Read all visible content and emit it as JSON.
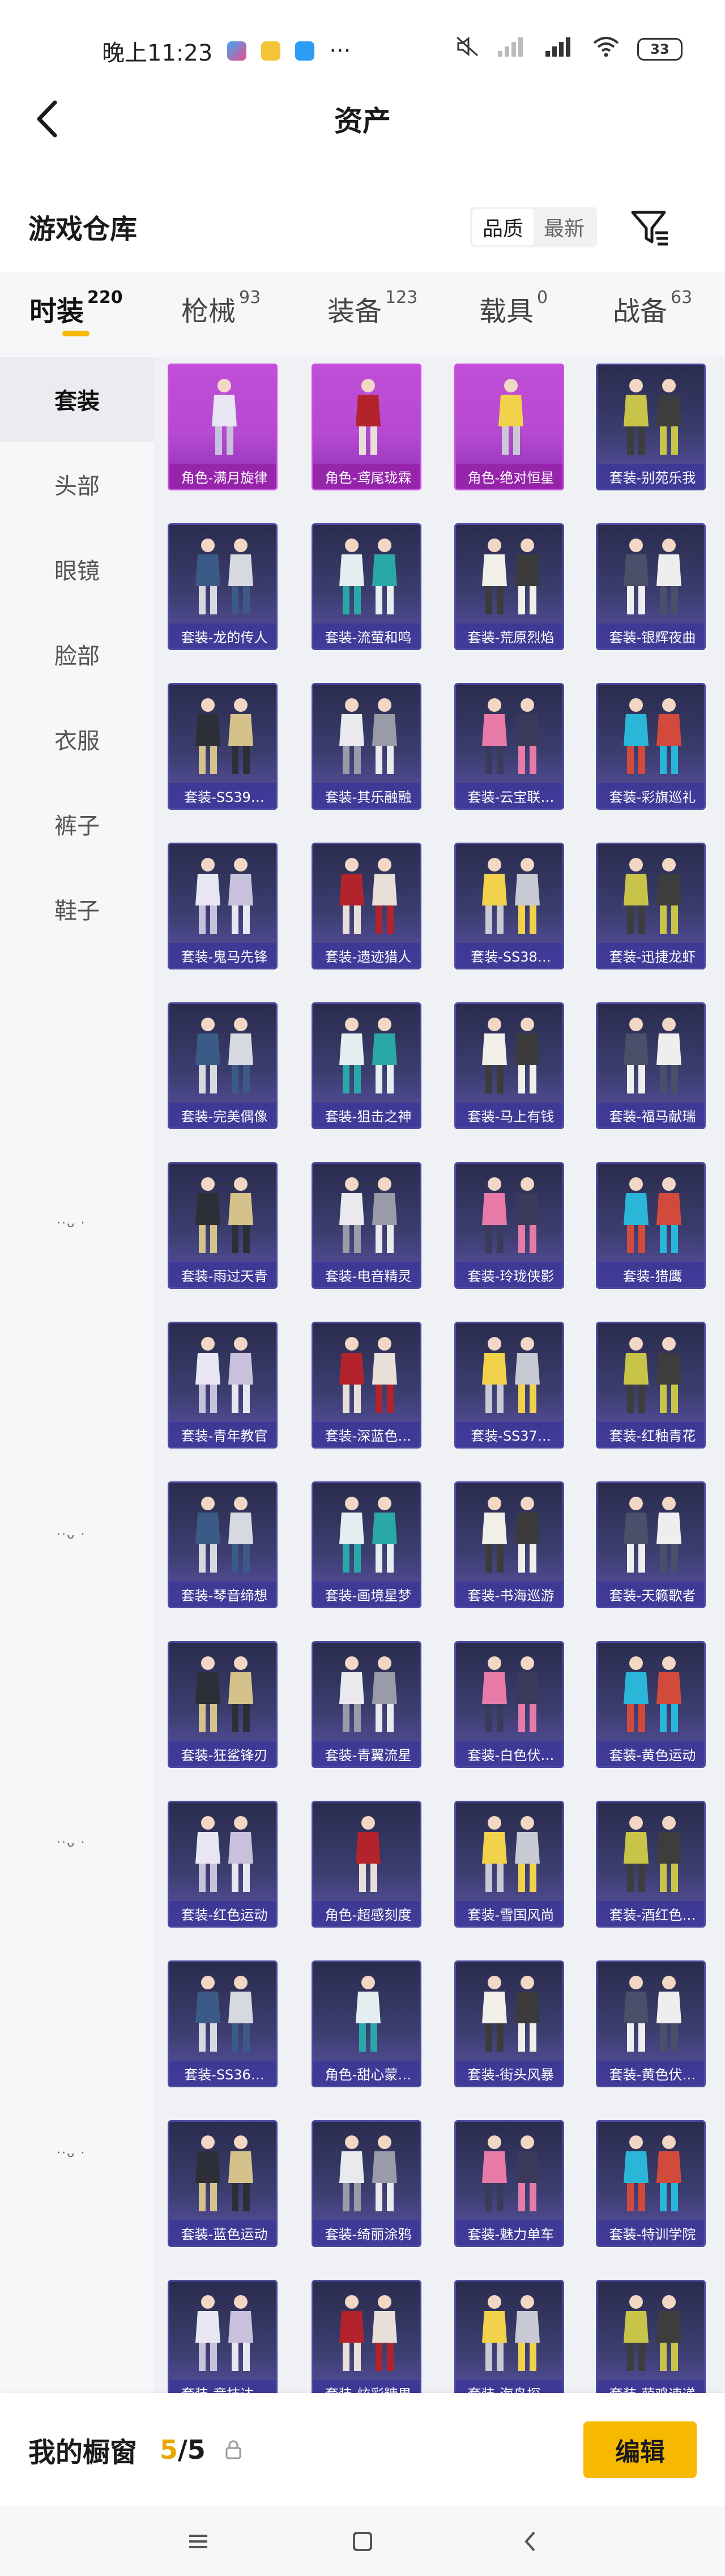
{
  "status_bar": {
    "time": "晚上11:23",
    "more": "···",
    "battery": "33"
  },
  "header": {
    "title": "资产"
  },
  "warehouse": {
    "title": "游戏仓库",
    "sort_options": [
      "品质",
      "最新"
    ]
  },
  "tabs": [
    {
      "label": "时装",
      "count": "220"
    },
    {
      "label": "枪械",
      "count": "93"
    },
    {
      "label": "装备",
      "count": "123"
    },
    {
      "label": "载具",
      "count": "0"
    },
    {
      "label": "战备",
      "count": "63"
    }
  ],
  "sidebar": {
    "items": [
      "套装",
      "头部",
      "眼镜",
      "脸部",
      "衣服",
      "裤子",
      "鞋子"
    ],
    "ghost": "··ᴗ ·"
  },
  "grid": {
    "items": [
      "角色-满月旋律",
      "角色-鸢尾珑霖",
      "角色-绝对恒星",
      "套装-别苑乐我",
      "套装-龙的传人",
      "套装-流萤和鸣",
      "套装-荒原烈焰",
      "套装-银辉夜曲",
      "套装-SS39…",
      "套装-其乐融融",
      "套装-云宝联…",
      "套装-彩旗巡礼",
      "套装-鬼马先锋",
      "套装-遗迹猎人",
      "套装-SS38…",
      "套装-迅捷龙虾",
      "套装-完美偶像",
      "套装-狙击之神",
      "套装-马上有钱",
      "套装-福马献瑞",
      "套装-雨过天青",
      "套装-电音精灵",
      "套装-玲珑侠影",
      "套装-猎鹰",
      "套装-青年教官",
      "套装-深蓝色…",
      "套装-SS37…",
      "套装-红釉青花",
      "套装-琴音缔想",
      "套装-画境星梦",
      "套装-书海巡游",
      "套装-天籁歌者",
      "套装-狂鲨锋刃",
      "套装-青翼流星",
      "套装-白色伏…",
      "套装-黄色运动",
      "套装-红色运动",
      "角色-超感刻度",
      "套装-雪国风尚",
      "套装-酒红色…",
      "套装-SS36…",
      "角色-甜心蒙…",
      "套装-街头风暴",
      "套装-黄色伏…",
      "套装-蓝色运动",
      "套装-绮丽涂鸦",
      "套装-魅力单车",
      "套装-特训学院",
      "套装-竞技达…",
      "套装-炫彩糖果",
      "套装-海岛探…",
      "套装-萌鸡速递"
    ]
  },
  "bottom": {
    "title": "我的橱窗",
    "current": "5",
    "separator": "/",
    "total": "5",
    "edit": "编辑"
  },
  "colors": {
    "accent": "#f7b900",
    "card_blue": "#3b3d6e",
    "card_pink": "#c04ed8"
  }
}
